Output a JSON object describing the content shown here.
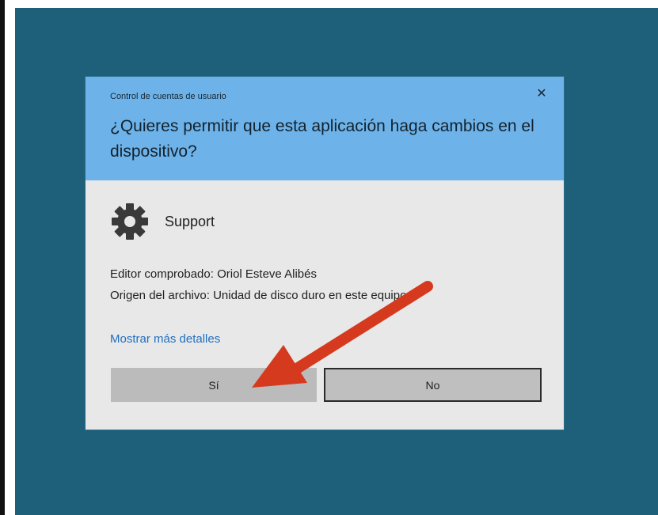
{
  "dialog": {
    "title": "Control de cuentas de usuario",
    "close_glyph": "✕",
    "question": "¿Quieres permitir que esta aplicación haga cambios en el dispositivo?",
    "app_name": "Support",
    "app_icon": "gear-icon",
    "publisher_line": "Editor comprobado: Oriol Esteve Alibés",
    "origin_line": "Origen del archivo: Unidad de disco duro en este equipo",
    "details_link": "Mostrar más detalles",
    "yes_label": "Sí",
    "no_label": "No"
  },
  "colors": {
    "desktop": "#1e5f7a",
    "header": "#6db3e9",
    "body": "#e8e8e8",
    "link": "#1f6fc1",
    "arrow": "#d63a1e"
  }
}
